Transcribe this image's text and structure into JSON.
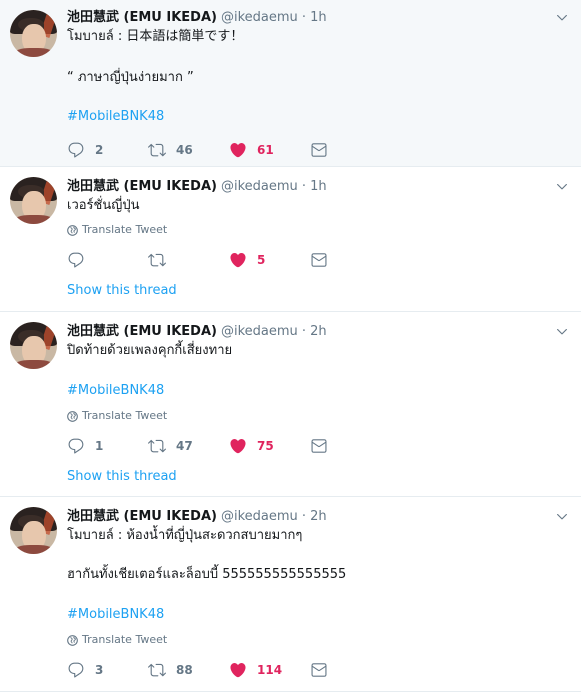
{
  "colors": {
    "link": "#1da1f2",
    "like": "#e0245e",
    "muted": "#657786",
    "highlight_bg": "#f5f8fa"
  },
  "tweets": [
    {
      "author_name": "池田慧武 (EMU IKEDA)",
      "handle_time": "@ikedaemu · 1h",
      "lines": [
        "โมบายล์ : 日本語は簡単です！",
        "“ ภาษาญี่ปุ่นง่ายมาก ”"
      ],
      "hashtag": "#MobileBNK48",
      "replies": "2",
      "retweets": "46",
      "likes": "61"
    },
    {
      "author_name": "池田慧武 (EMU IKEDA)",
      "handle_time": "@ikedaemu · 1h",
      "lines": [
        "เวอร์ชั่นญี่ปุ่น"
      ],
      "translate": "Translate Tweet",
      "likes": "5",
      "show_thread": "Show this thread"
    },
    {
      "author_name": "池田慧武 (EMU IKEDA)",
      "handle_time": "@ikedaemu · 2h",
      "lines": [
        "ปิดท้ายด้วยเพลงคุกกี้เสี่ยงทาย"
      ],
      "hashtag": "#MobileBNK48",
      "translate": "Translate Tweet",
      "replies": "1",
      "retweets": "47",
      "likes": "75",
      "show_thread": "Show this thread"
    },
    {
      "author_name": "池田慧武 (EMU IKEDA)",
      "handle_time": "@ikedaemu · 2h",
      "lines": [
        "โมบายล์ : ห้องน้ำที่ญี่ปุ่นสะดวกสบายมากๆ",
        "ฮากันทั้งเชียเตอร์และล็อบบี้ 555555555555555"
      ],
      "hashtag": "#MobileBNK48",
      "translate": "Translate Tweet",
      "replies": "3",
      "retweets": "88",
      "likes": "114"
    }
  ]
}
